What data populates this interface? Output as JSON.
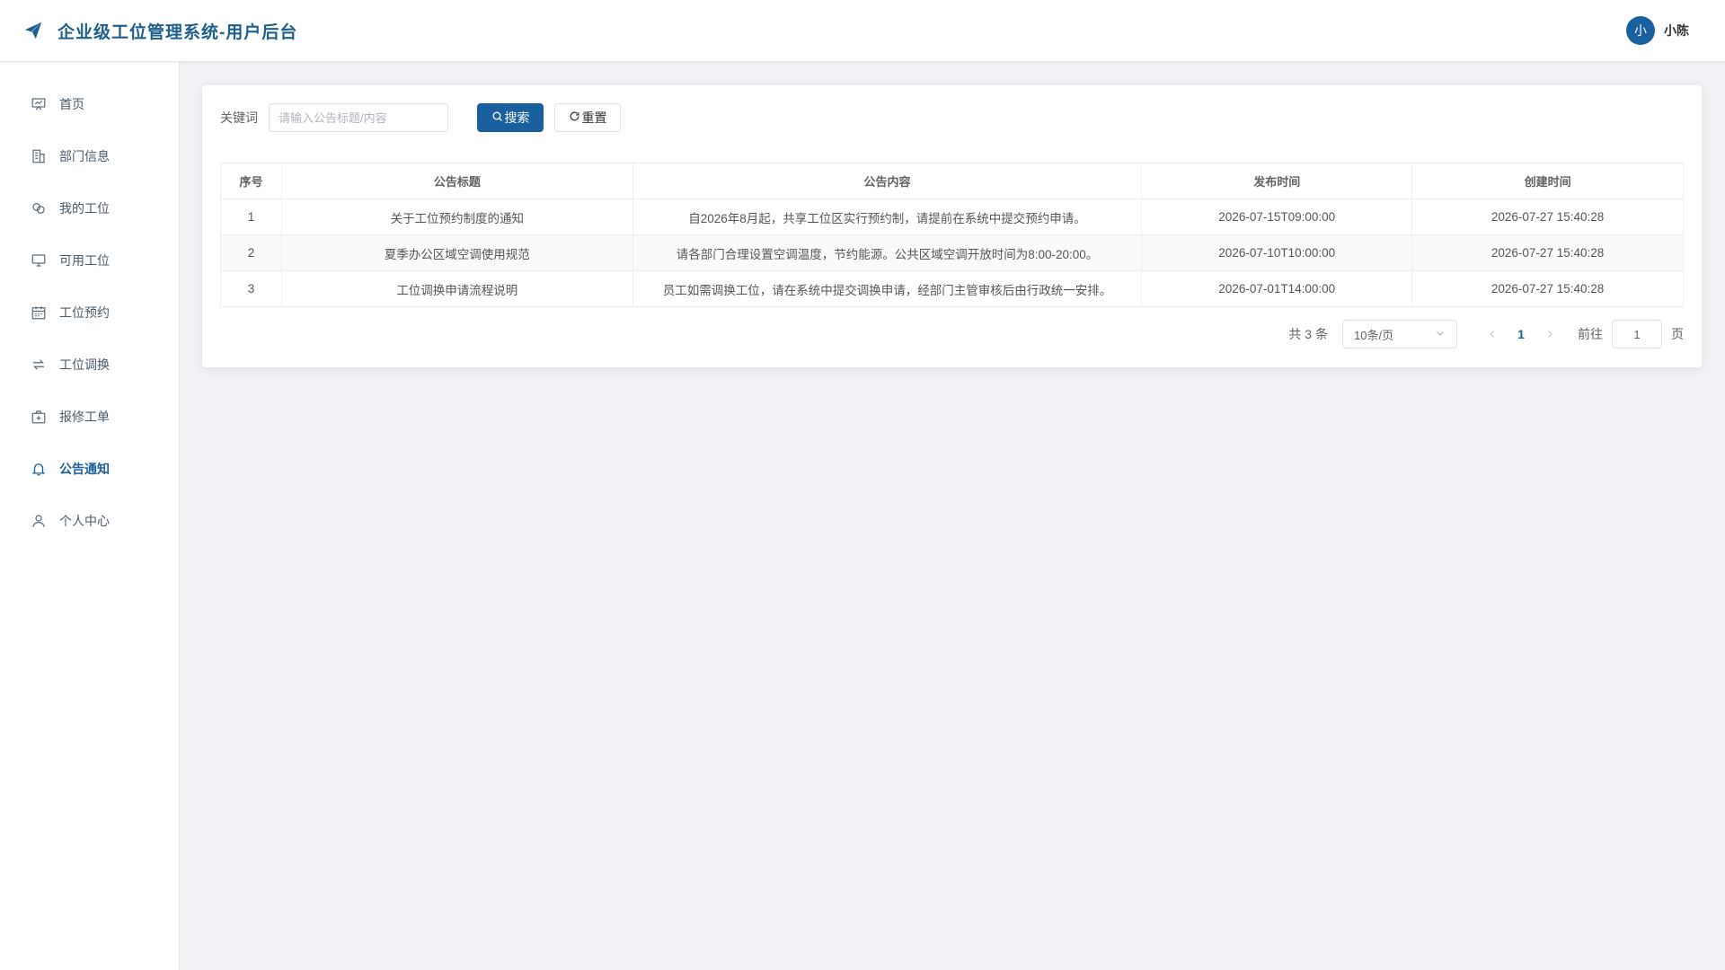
{
  "header": {
    "title": "企业级工位管理系统-用户后台",
    "logo_icon": "paper-plane-icon",
    "brand_color": "#1f5f8b"
  },
  "user": {
    "avatar_text": "小",
    "name": "小陈",
    "avatar_color": "#1a5f9e"
  },
  "sidebar": {
    "items": [
      {
        "label": "首页",
        "icon": "presentation-icon",
        "active": false
      },
      {
        "label": "部门信息",
        "icon": "building-icon",
        "active": false
      },
      {
        "label": "我的工位",
        "icon": "link-icon",
        "active": false
      },
      {
        "label": "可用工位",
        "icon": "monitor-icon",
        "active": false
      },
      {
        "label": "工位预约",
        "icon": "calendar-icon",
        "active": false
      },
      {
        "label": "工位调换",
        "icon": "swap-icon",
        "active": false
      },
      {
        "label": "报修工单",
        "icon": "first-aid-kit-icon",
        "active": false
      },
      {
        "label": "公告通知",
        "icon": "bell-icon",
        "active": true
      },
      {
        "label": "个人中心",
        "icon": "user-icon",
        "active": false
      }
    ]
  },
  "search": {
    "label": "关键词",
    "placeholder": "请输入公告标题/内容",
    "value": "",
    "search_label": "搜索",
    "reset_label": "重置"
  },
  "table": {
    "columns": [
      "序号",
      "公告标题",
      "公告内容",
      "发布时间",
      "创建时间"
    ],
    "rows": [
      [
        "1",
        "关于工位预约制度的通知",
        "自2026年8月起，共享工位区实行预约制，请提前在系统中提交预约申请。",
        "2026-07-15T09:00:00",
        "2026-07-27 15:40:28"
      ],
      [
        "2",
        "夏季办公区域空调使用规范",
        "请各部门合理设置空调温度，节约能源。公共区域空调开放时间为8:00-20:00。",
        "2026-07-10T10:00:00",
        "2026-07-27 15:40:28"
      ],
      [
        "3",
        "工位调换申请流程说明",
        "员工如需调换工位，请在系统中提交调换申请，经部门主管审核后由行政统一安排。",
        "2026-07-01T14:00:00",
        "2026-07-27 15:40:28"
      ]
    ]
  },
  "pagination": {
    "total_text": "共 3 条",
    "page_size": "10条/页",
    "current_page": "1",
    "goto_label": "前往",
    "goto_value": "1",
    "page_unit": "页"
  }
}
